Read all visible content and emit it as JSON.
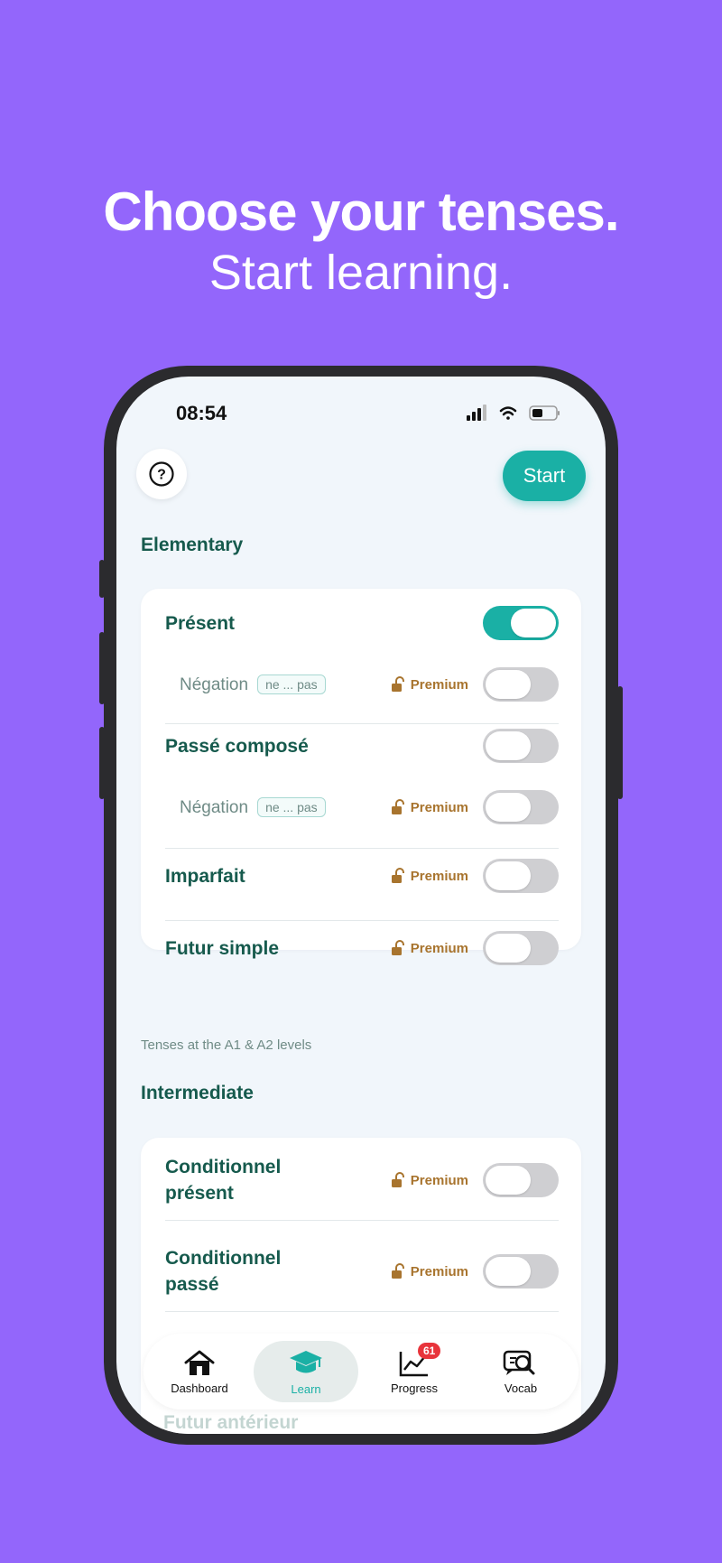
{
  "headline": {
    "title": "Choose your tenses.",
    "subtitle": "Start learning."
  },
  "status_bar": {
    "time": "08:54"
  },
  "top_bar": {
    "start_label": "Start"
  },
  "elementary": {
    "title": "Elementary",
    "rows": [
      {
        "label": "Présent",
        "on": true
      },
      {
        "label": "Négation",
        "tag": "ne ... pas",
        "premium": "Premium",
        "on": false
      },
      {
        "label": "Passé composé",
        "on": false
      },
      {
        "label": "Négation",
        "tag": "ne ... pas",
        "premium": "Premium",
        "on": false
      },
      {
        "label": "Imparfait",
        "premium": "Premium",
        "on": false
      },
      {
        "label": "Futur simple",
        "premium": "Premium",
        "on": false
      }
    ],
    "note": "Tenses at the A1 & A2 levels"
  },
  "intermediate": {
    "title": "Intermediate",
    "rows": [
      {
        "label_line1": "Conditionnel",
        "label_line2": "présent",
        "premium": "Premium",
        "on": false
      },
      {
        "label_line1": "Conditionnel",
        "label_line2": "passé",
        "premium": "Premium",
        "on": false
      }
    ],
    "hidden_row": "Futur antérieur"
  },
  "tab_bar": {
    "tabs": [
      {
        "label": "Dashboard",
        "icon": "home-icon"
      },
      {
        "label": "Learn",
        "icon": "graduation-cap-icon",
        "active": true
      },
      {
        "label": "Progress",
        "icon": "chart-line-icon",
        "badge": "61"
      },
      {
        "label": "Vocab",
        "icon": "vocab-search-icon"
      }
    ]
  },
  "colors": {
    "background": "#9366fb",
    "accent": "#1ab0a5",
    "text": "#165a4d",
    "premium": "#a8742e"
  }
}
